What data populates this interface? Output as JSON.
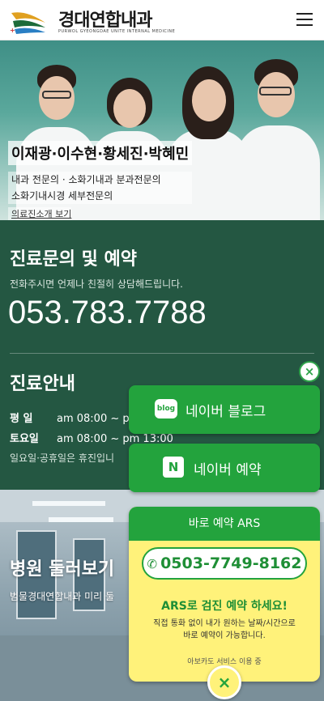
{
  "header": {
    "logo_text": "경대연합내과",
    "logo_eng": "PURWOL GYEONGDAE UNITE INTERNAL MEDICINE"
  },
  "hero": {
    "doctor_names": "이재광·이수현·황세진·박혜민",
    "desc_line1": "내과 전문의 · 소화기내과 분과전문의",
    "desc_line2": "소화기내시경 세부전문의",
    "link_label": "의료진소개 보기"
  },
  "contact": {
    "title": "진료문의 및 예약",
    "subtitle": "전화주시면 언제나 친절히 상담해드립니다.",
    "phone": "053.783.7788"
  },
  "hours": {
    "title": "진료안내",
    "weekday_label": "평   일",
    "weekday_time": "am 08:00 ~ p",
    "saturday_label": "토요일",
    "saturday_time": "am 08:00 ~ pm 13:00",
    "holiday_note": "일요일·공휴일은 휴진입니"
  },
  "tour": {
    "title": "병원 둘러보기",
    "desc": "범물경대연합내과 미리 둘"
  },
  "floating": {
    "close_symbol": "×",
    "blog_icon_text": "blog",
    "blog_label": "네이버 블로그",
    "reserve_icon_text": "N",
    "reserve_label": "네이버 예약"
  },
  "ars": {
    "header": "바로 예약 ARS",
    "phone_icon": "✆",
    "phone": "0503-7749-8162",
    "cta": "ARS로 검진 예약 하세요!",
    "desc_line1": "직접 통화 없이 내가 원하는 날짜/시간으로",
    "desc_line2": "바로 예약이 가능합니다.",
    "footer": "아보카도 서비스 이용 중",
    "close_symbol": "×"
  },
  "colors": {
    "brand_green": "#23a33d",
    "section_green": "#245742",
    "ars_yellow": "#fff27a"
  }
}
